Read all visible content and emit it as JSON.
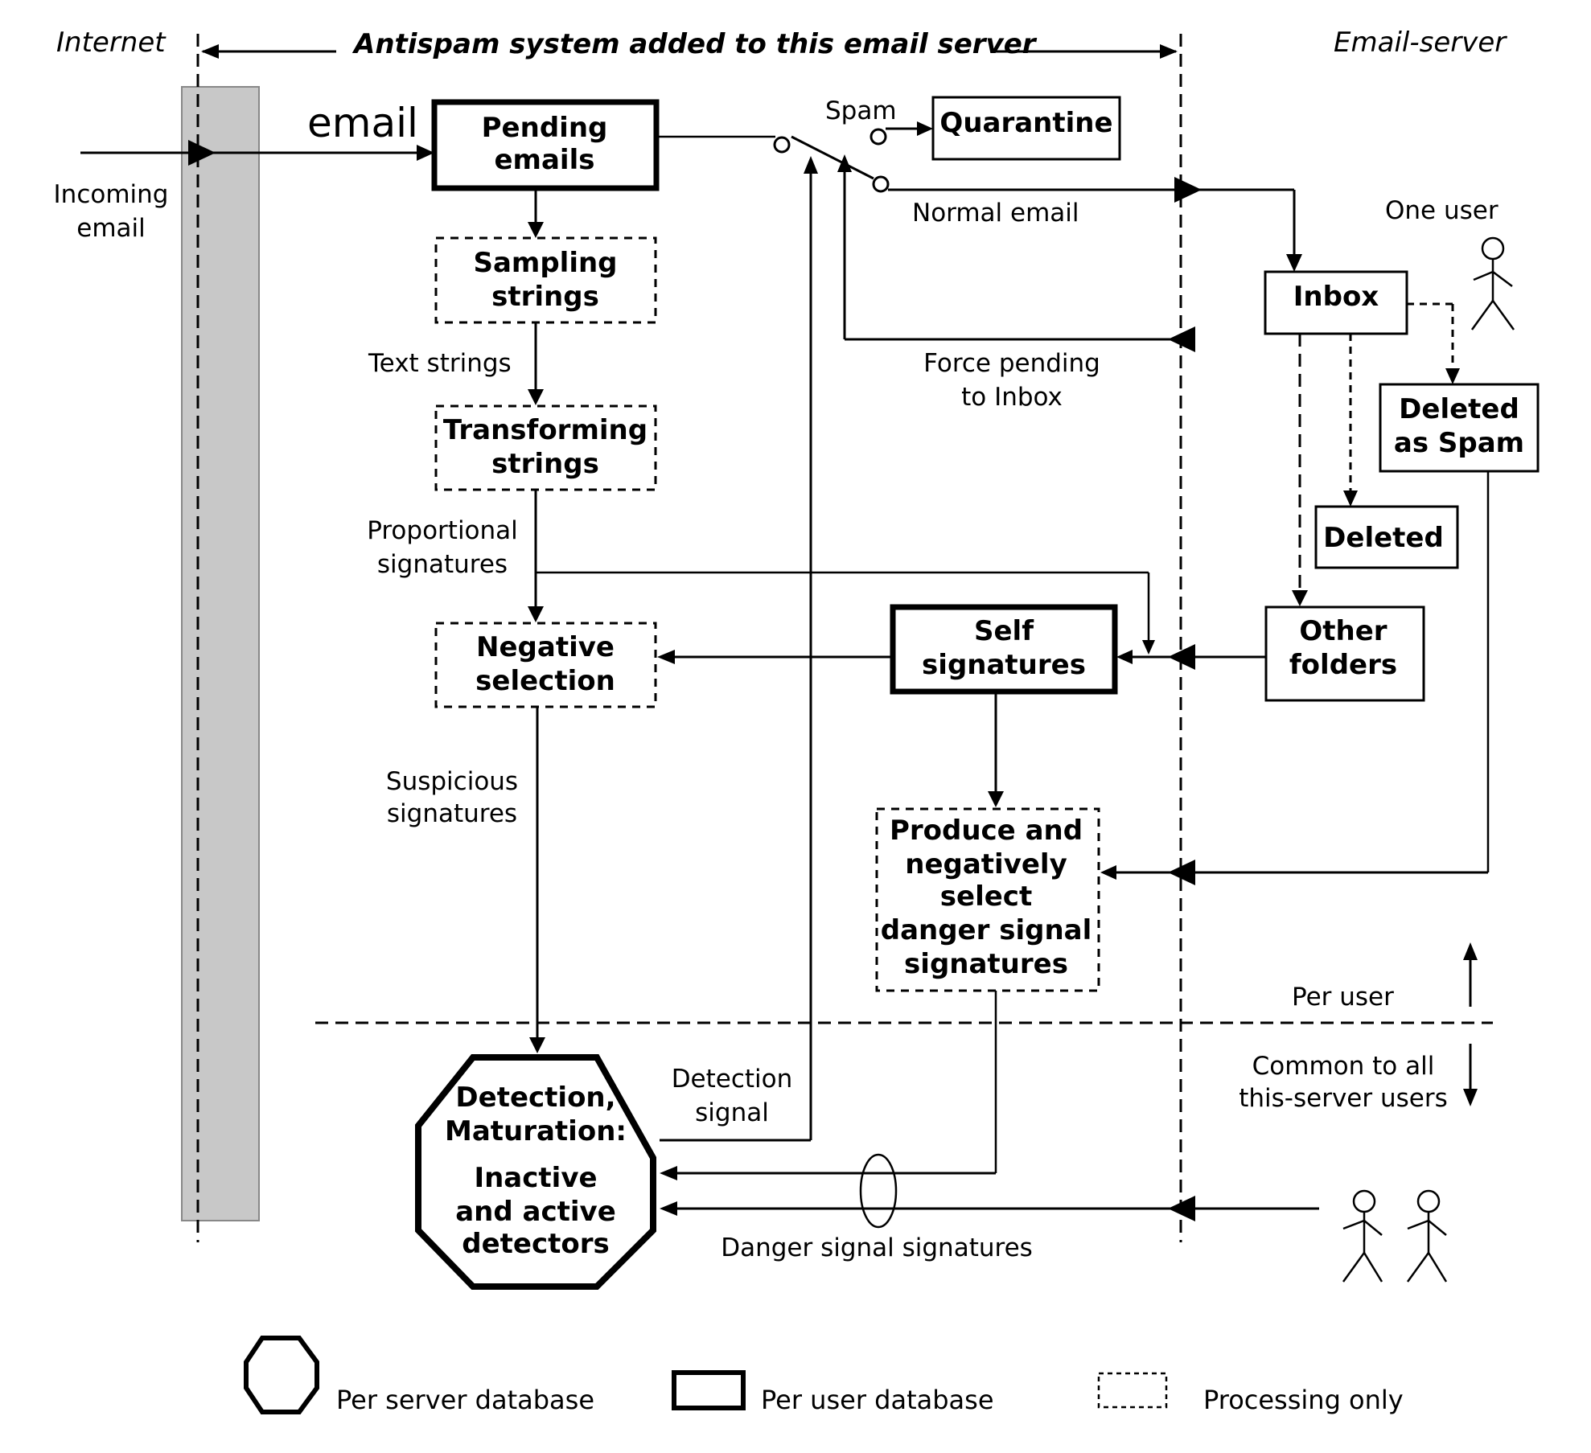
{
  "regions": {
    "internet": "Internet",
    "antispam": "Antispam system added to this email server",
    "email_server": "Email-server"
  },
  "nodes": {
    "pending_emails": [
      "Pending",
      "emails"
    ],
    "quarantine": [
      "Quarantine"
    ],
    "sampling_strings": [
      "Sampling",
      "strings"
    ],
    "transforming_strings": [
      "Transforming",
      "strings"
    ],
    "negative_selection": [
      "Negative",
      "selection"
    ],
    "self_signatures": [
      "Self",
      "signatures"
    ],
    "produce_danger": [
      "Produce and",
      "negatively",
      "select",
      "danger signal",
      "signatures"
    ],
    "detection": [
      "Detection,",
      "Maturation:",
      "Inactive",
      "and active",
      "detectors"
    ],
    "inbox": [
      "Inbox"
    ],
    "deleted_as_spam": [
      "Deleted",
      "as Spam"
    ],
    "deleted": [
      "Deleted"
    ],
    "other_folders": [
      "Other",
      "folders"
    ]
  },
  "edge_labels": {
    "email": "email",
    "incoming_email": [
      "Incoming",
      "email"
    ],
    "spam": "Spam",
    "normal_email": "Normal email",
    "force_pending": [
      "Force pending",
      "to Inbox"
    ],
    "text_strings": "Text strings",
    "proportional_signatures": [
      "Proportional",
      "signatures"
    ],
    "suspicious_signatures": [
      "Suspicious",
      "signatures"
    ],
    "detection_signal": [
      "Detection",
      "signal"
    ],
    "danger_signal_signatures": "Danger signal signatures",
    "one_user": "One user",
    "per_user": "Per user",
    "common_to_all": [
      "Common to all",
      "this-server users"
    ]
  },
  "legend": {
    "per_server_database": "Per server database",
    "per_user_database": "Per user database",
    "processing_only": "Processing only"
  }
}
